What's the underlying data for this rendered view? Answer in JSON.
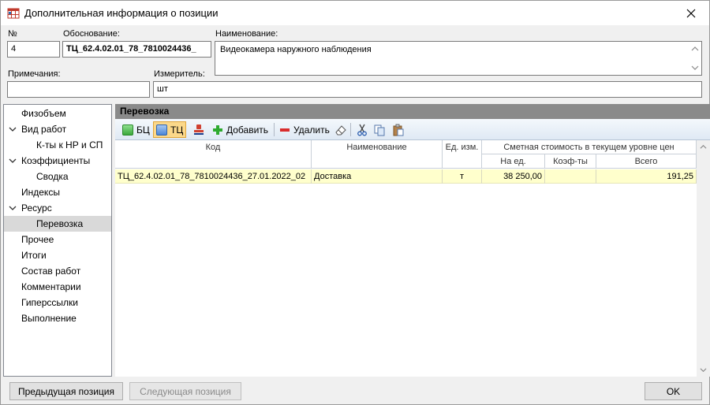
{
  "window": {
    "title": "Дополнительная информация о позиции"
  },
  "form": {
    "number_label": "№",
    "number_value": "4",
    "basis_label": "Обоснование:",
    "basis_value": "ТЦ_62.4.02.01_78_7810024436_",
    "name_label": "Наименование:",
    "name_value": "Видеокамера наружного наблюдения",
    "notes_label": "Примечания:",
    "notes_value": "",
    "unit_label": "Измеритель:",
    "unit_value": "шт"
  },
  "tree": {
    "items": [
      {
        "label": "Физобъем",
        "level": 0,
        "expandable": false
      },
      {
        "label": "Вид работ",
        "level": 0,
        "expandable": true
      },
      {
        "label": "К-ты к НР и СП",
        "level": 1,
        "expandable": false
      },
      {
        "label": "Коэффициенты",
        "level": 0,
        "expandable": true
      },
      {
        "label": "Сводка",
        "level": 1,
        "expandable": false
      },
      {
        "label": "Индексы",
        "level": 0,
        "expandable": false
      },
      {
        "label": "Ресурс",
        "level": 0,
        "expandable": true
      },
      {
        "label": "Перевозка",
        "level": 1,
        "expandable": false,
        "selected": true
      },
      {
        "label": "Прочее",
        "level": 0,
        "expandable": false
      },
      {
        "label": "Итоги",
        "level": 0,
        "expandable": false
      },
      {
        "label": "Состав работ",
        "level": 0,
        "expandable": false
      },
      {
        "label": "Комментарии",
        "level": 0,
        "expandable": false
      },
      {
        "label": "Гиперссылки",
        "level": 0,
        "expandable": false
      },
      {
        "label": "Выполнение",
        "level": 0,
        "expandable": false
      }
    ]
  },
  "panel": {
    "title": "Перевозка"
  },
  "toolbar": {
    "bc_label": "БЦ",
    "tc_label": "ТЦ",
    "add_label": "Добавить",
    "delete_label": "Удалить"
  },
  "grid": {
    "headers": {
      "code": "Код",
      "name": "Наименование",
      "unit": "Ед. изм.",
      "group": "Сметная стоимость в текущем уровне цен",
      "per_unit": "На ед.",
      "coef": "Коэф-ты",
      "total": "Всего"
    },
    "rows": [
      {
        "code": "ТЦ_62.4.02.01_78_7810024436_27.01.2022_02",
        "name": "Доставка",
        "unit": "т",
        "per_unit": "38 250,00",
        "coef": "",
        "total": "191,25"
      }
    ]
  },
  "buttons": {
    "prev": "Предыдущая позиция",
    "next": "Следующая позиция",
    "ok": "OK"
  },
  "colors": {
    "selected_row": "#ffffcc",
    "panel_header": "#8a8a8a",
    "tree_selected": "#d9d9d9"
  }
}
